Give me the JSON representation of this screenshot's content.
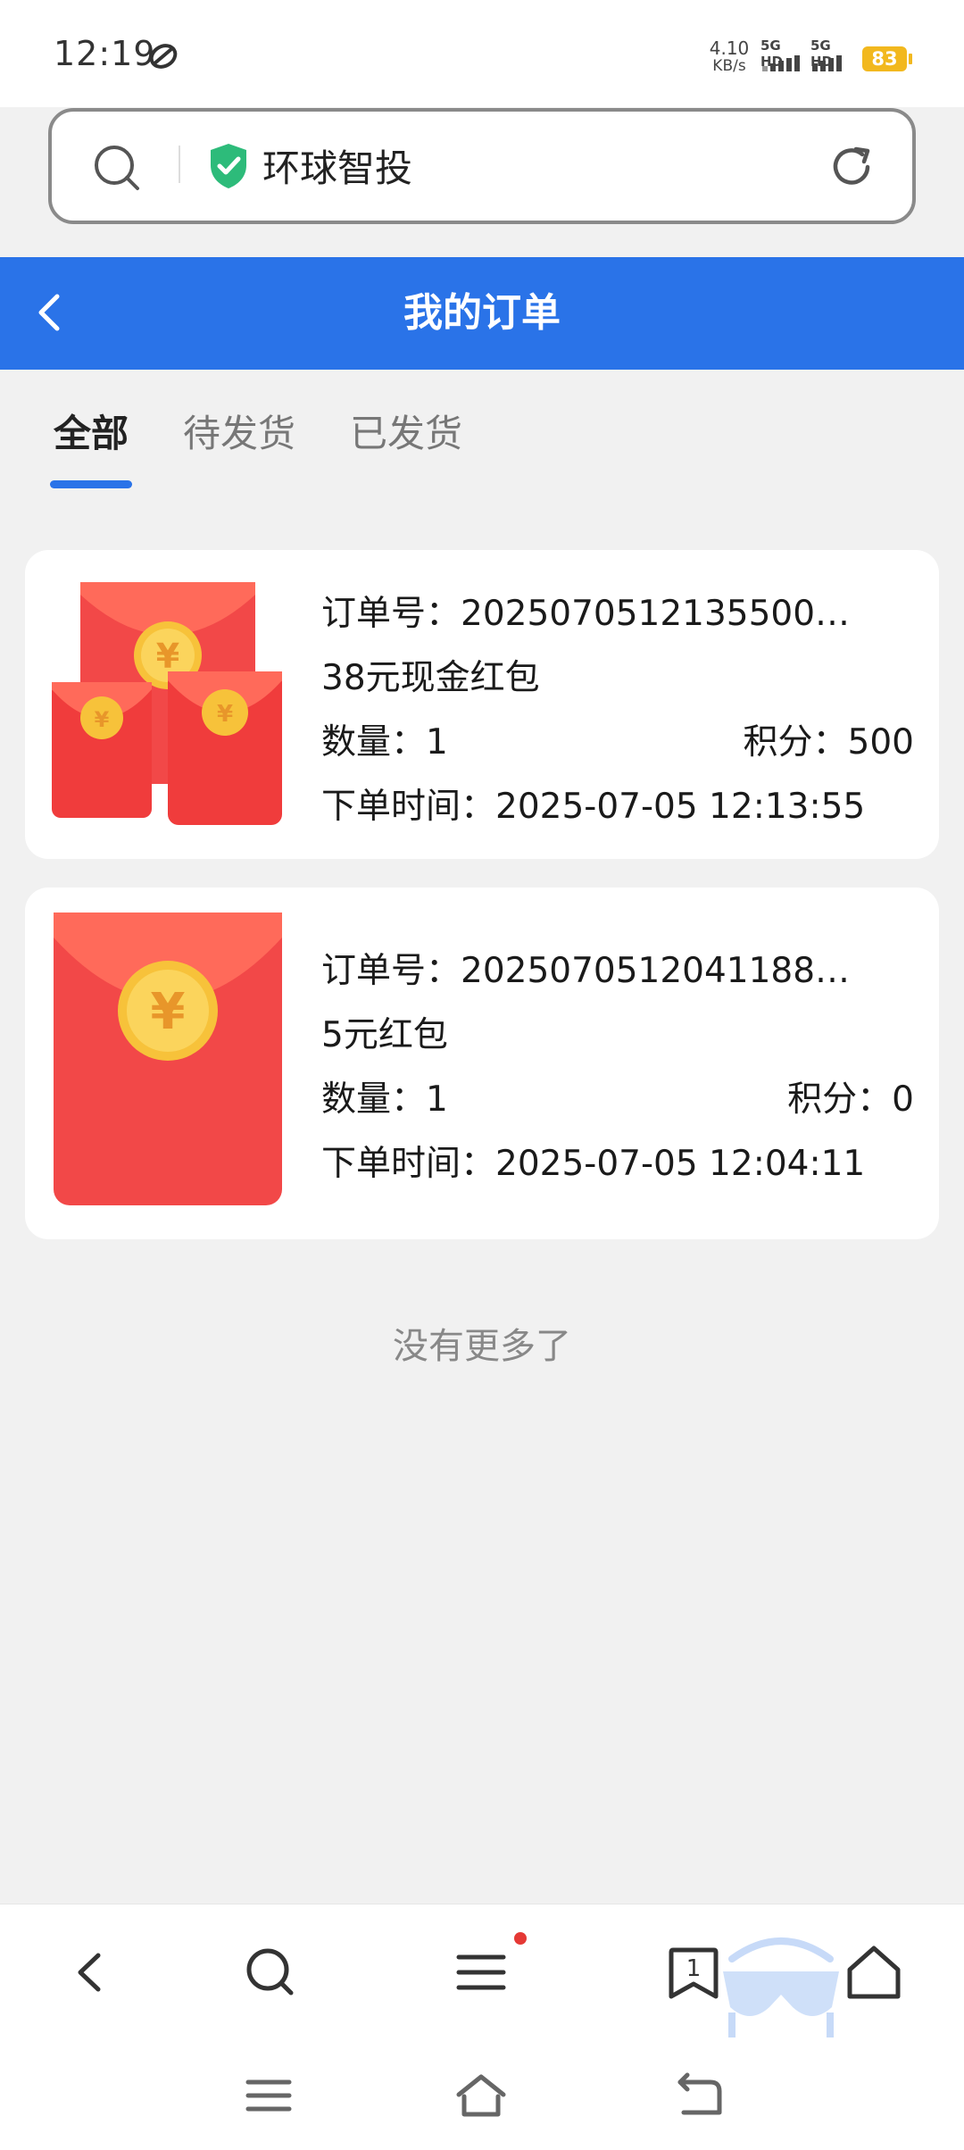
{
  "status": {
    "time": "12:19",
    "net_speed_value": "4.10",
    "net_speed_unit": "KB/s",
    "sim1_label": "5G HD",
    "sim2_label": "5G HD",
    "battery": "83"
  },
  "address_bar": {
    "site_name": "环球智投"
  },
  "header": {
    "title": "我的订单"
  },
  "tabs": [
    {
      "label": "全部",
      "active": true
    },
    {
      "label": "待发货",
      "active": false
    },
    {
      "label": "已发货",
      "active": false
    }
  ],
  "orders": [
    {
      "order_no_label": "订单号：",
      "order_no": "2025070512135500…",
      "product": "38元现金红包",
      "quantity_label": "数量：",
      "quantity": "1",
      "points_label": "积分：",
      "points": "500",
      "time_label": "下单时间：",
      "time": "2025-07-05 12:13:55",
      "image": "three-red-envelopes-icon"
    },
    {
      "order_no_label": "订单号：",
      "order_no": "2025070512041188…",
      "product": "5元红包",
      "quantity_label": "数量：",
      "quantity": "1",
      "points_label": "积分：",
      "points": "0",
      "time_label": "下单时间：",
      "time": "2025-07-05 12:04:11",
      "image": "red-envelope-icon"
    }
  ],
  "footer_text": "没有更多了",
  "browser_nav": {
    "tab_count": "1",
    "icons": [
      "back-icon",
      "search-icon",
      "menu-icon",
      "tabs-icon",
      "home-icon"
    ]
  },
  "system_nav": {
    "icons": [
      "recent-apps-icon",
      "system-home-icon",
      "system-back-icon"
    ]
  },
  "colors": {
    "header_blue": "#2a73e8",
    "envelope_red": "#f04040",
    "coin_gold": "#f7c23a",
    "shield_green": "#2dbb7a",
    "battery_yellow": "#f2b81e"
  }
}
